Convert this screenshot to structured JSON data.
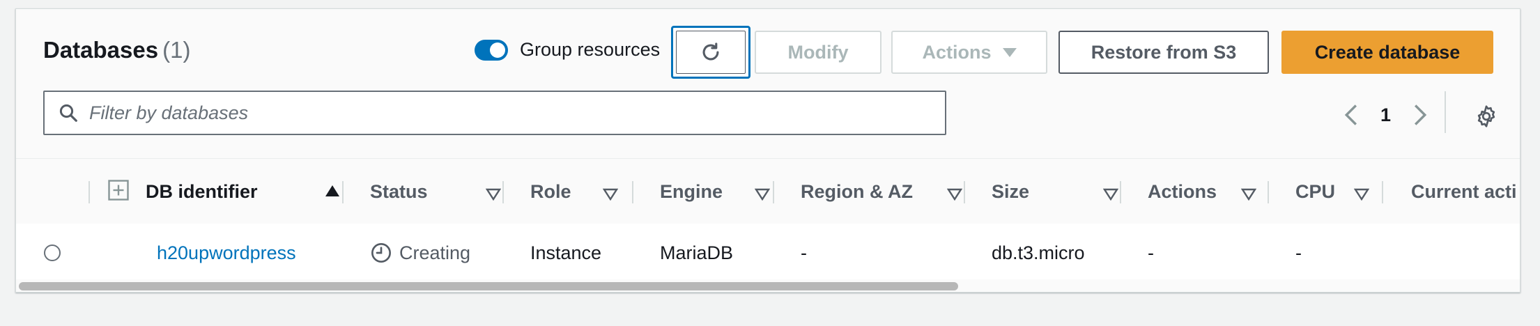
{
  "header": {
    "title": "Databases",
    "count": "(1)"
  },
  "toolbar": {
    "group_resources_label": "Group resources",
    "group_resources_on": true,
    "modify_label": "Modify",
    "actions_label": "Actions",
    "restore_label": "Restore from S3",
    "create_label": "Create database"
  },
  "filter": {
    "placeholder": "Filter by databases",
    "value": ""
  },
  "pagination": {
    "current_page": "1"
  },
  "table": {
    "columns": [
      "DB identifier",
      "Status",
      "Role",
      "Engine",
      "Region & AZ",
      "Size",
      "Actions",
      "CPU",
      "Current acti"
    ],
    "rows": [
      {
        "db_identifier": "h20upwordpress",
        "status": "Creating",
        "role": "Instance",
        "engine": "MariaDB",
        "region_az": "-",
        "size": "db.t3.micro",
        "actions": "-",
        "cpu": "-"
      }
    ]
  },
  "colors": {
    "accent": "#0073bb",
    "primary_button": "#ec9f31",
    "disabled_text": "#aab7b8"
  }
}
